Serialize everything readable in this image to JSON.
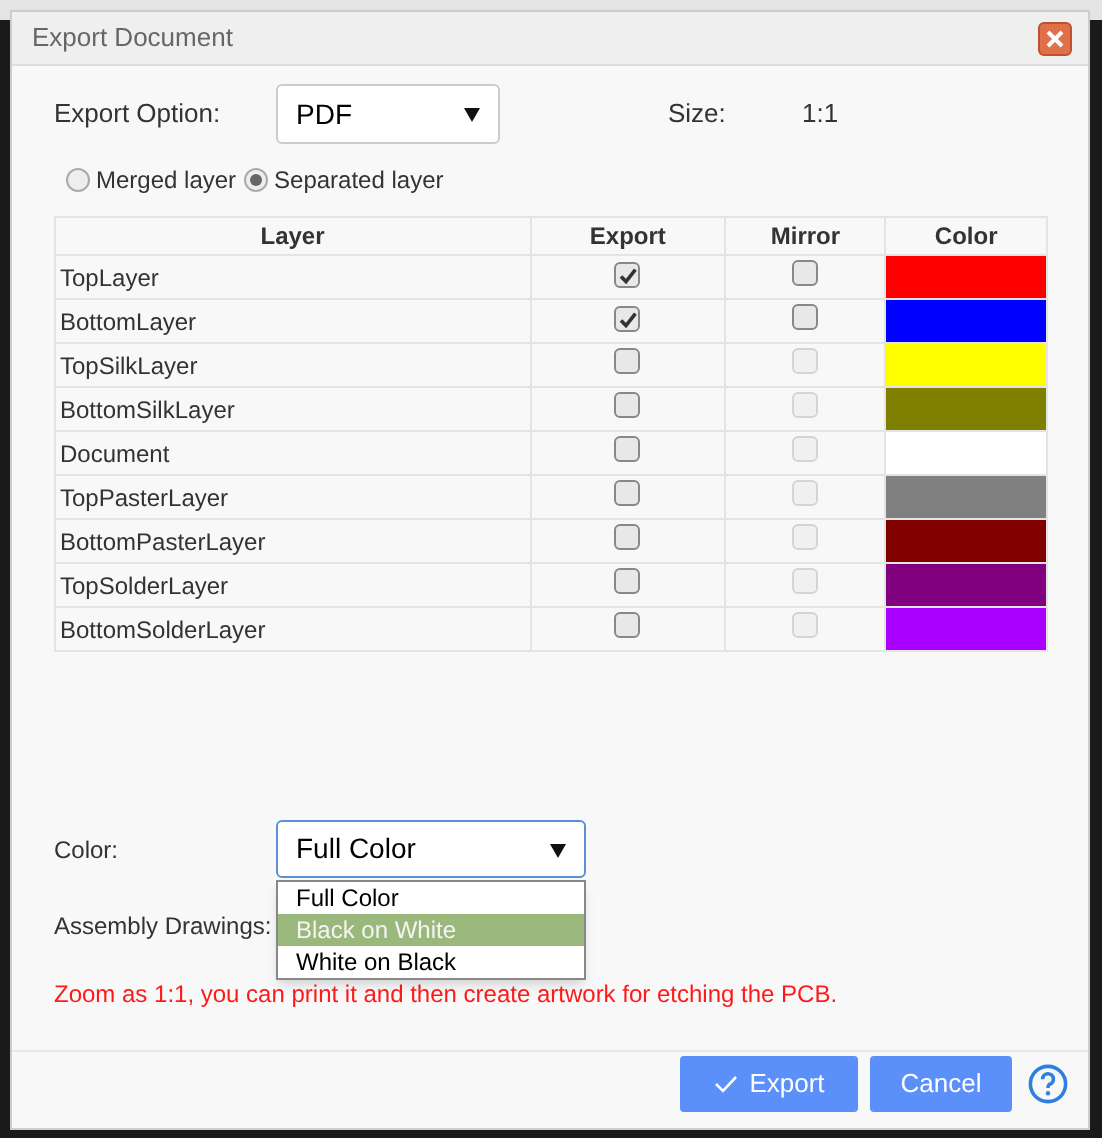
{
  "dialog": {
    "title": "Export Document"
  },
  "export_option": {
    "label": "Export Option:",
    "value": "PDF"
  },
  "size": {
    "label": "Size:",
    "value": "1:1"
  },
  "layer_mode": [
    {
      "label": "Merged layer",
      "selected": false
    },
    {
      "label": "Separated layer",
      "selected": true
    }
  ],
  "table": {
    "columns": [
      "Layer",
      "Export",
      "Mirror",
      "Color"
    ],
    "rows": [
      {
        "name": "TopLayer",
        "export": true,
        "mirror": false,
        "mirror_disabled": false,
        "color": "#ff0000"
      },
      {
        "name": "BottomLayer",
        "export": true,
        "mirror": false,
        "mirror_disabled": false,
        "color": "#0000ff"
      },
      {
        "name": "TopSilkLayer",
        "export": false,
        "mirror": false,
        "mirror_disabled": true,
        "color": "#ffff00"
      },
      {
        "name": "BottomSilkLayer",
        "export": false,
        "mirror": false,
        "mirror_disabled": true,
        "color": "#808000"
      },
      {
        "name": "Document",
        "export": false,
        "mirror": false,
        "mirror_disabled": true,
        "color": "#ffffff"
      },
      {
        "name": "TopPasterLayer",
        "export": false,
        "mirror": false,
        "mirror_disabled": true,
        "color": "#808080"
      },
      {
        "name": "BottomPasterLayer",
        "export": false,
        "mirror": false,
        "mirror_disabled": true,
        "color": "#800000"
      },
      {
        "name": "TopSolderLayer",
        "export": false,
        "mirror": false,
        "mirror_disabled": true,
        "color": "#800080"
      },
      {
        "name": "BottomSolderLayer",
        "export": false,
        "mirror": false,
        "mirror_disabled": true,
        "color": "#aa00ff"
      }
    ]
  },
  "color": {
    "label": "Color:",
    "value": "Full Color",
    "expanded": true,
    "options": [
      {
        "label": "Full Color",
        "highlighted": false
      },
      {
        "label": "Black on White",
        "highlighted": true
      },
      {
        "label": "White on Black",
        "highlighted": false
      }
    ]
  },
  "assembly_drawings": {
    "label": "Assembly Drawings:"
  },
  "note": "Zoom as 1:1, you can print it and then create artwork for etching the PCB.",
  "buttons": {
    "export": "Export",
    "cancel": "Cancel"
  }
}
